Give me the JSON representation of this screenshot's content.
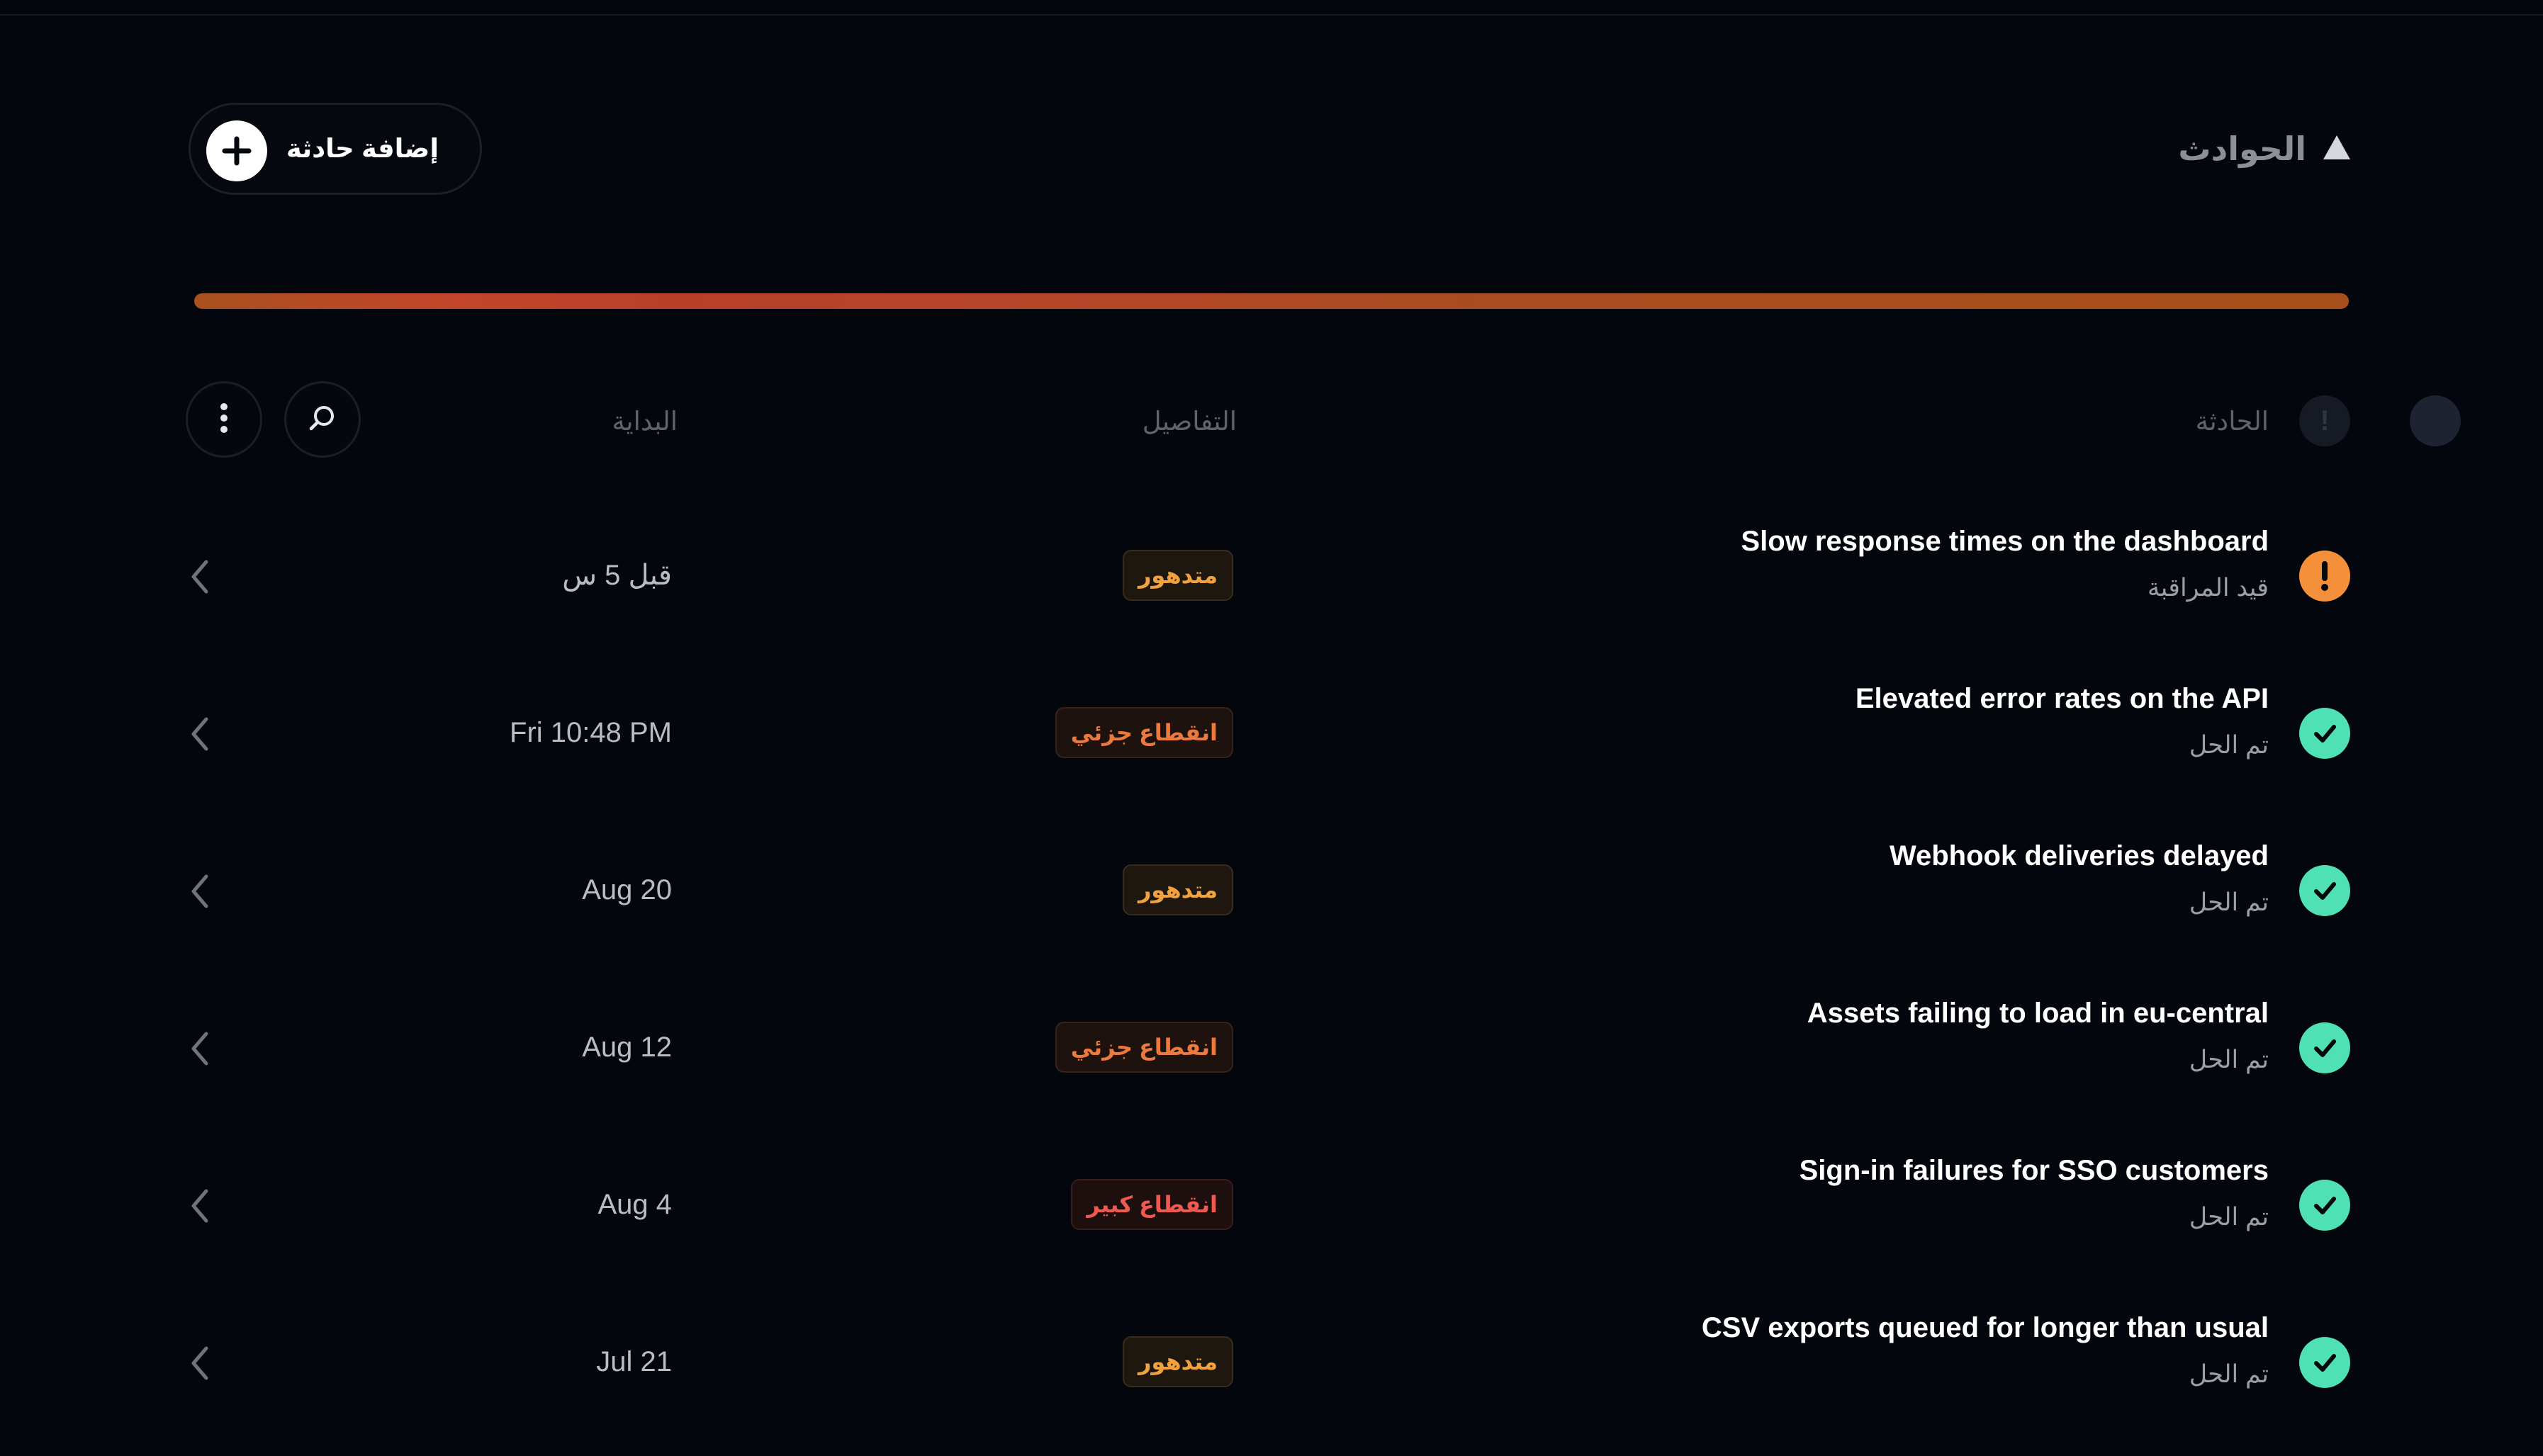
{
  "header": {
    "title": "الحوادث",
    "collapse_icon": "triangle-up-icon",
    "add_button_label": "إضافة حادثة",
    "add_icon": "plus-icon"
  },
  "colors": {
    "background": "#04060d",
    "monitoring": "#f5903a",
    "resolved": "#4fe0b3",
    "degraded": "#f1a23f",
    "partial_outage": "#ec7a3e",
    "major_outage": "#ee5a52"
  },
  "columns": {
    "incident": "الحادثة",
    "details": "التفاصيل",
    "start": "البداية"
  },
  "toolbar": {
    "search_icon": "search-icon",
    "more_icon": "more-vertical-icon"
  },
  "incidents": [
    {
      "name": "Slow response times on the dashboard",
      "status": "قيد المراقبة",
      "status_type": "monitoring",
      "badge": "متدهور",
      "badge_type": "degraded",
      "start": "قبل 5 س"
    },
    {
      "name": "Elevated error rates on the API",
      "status": "تم الحل",
      "status_type": "resolved",
      "badge": "انقطاع جزئي",
      "badge_type": "partial",
      "start": "Fri 10:48 PM"
    },
    {
      "name": "Webhook deliveries delayed",
      "status": "تم الحل",
      "status_type": "resolved",
      "badge": "متدهور",
      "badge_type": "degraded",
      "start": "Aug 20"
    },
    {
      "name": "Assets failing to load in eu-central",
      "status": "تم الحل",
      "status_type": "resolved",
      "badge": "انقطاع جزئي",
      "badge_type": "partial",
      "start": "Aug 12"
    },
    {
      "name": "Sign-in failures for SSO customers",
      "status": "تم الحل",
      "status_type": "resolved",
      "badge": "انقطاع كبير",
      "badge_type": "major",
      "start": "Aug 4"
    },
    {
      "name": "CSV exports queued for longer than usual",
      "status": "تم الحل",
      "status_type": "resolved",
      "badge": "متدهور",
      "badge_type": "degraded",
      "start": "Jul 21"
    }
  ]
}
